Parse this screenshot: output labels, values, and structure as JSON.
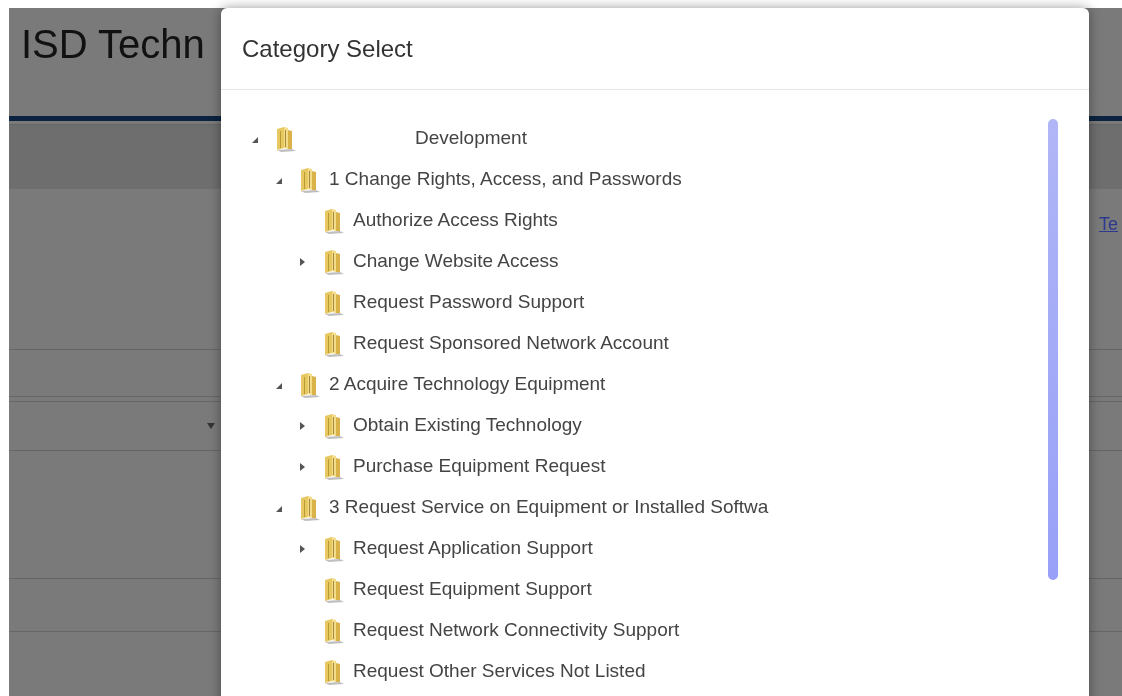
{
  "page": {
    "title": "ISD Techn",
    "link": "Te"
  },
  "dialog": {
    "title": "Category Select",
    "tree": [
      {
        "label": "Development",
        "expanded": true,
        "children": [
          {
            "label": "1 Change Rights, Access, and Passwords",
            "expanded": true,
            "children": [
              {
                "label": "Authorize Access Rights"
              },
              {
                "label": "Change Website Access",
                "expanded": false
              },
              {
                "label": "Request Password Support"
              },
              {
                "label": "Request Sponsored Network Account"
              }
            ]
          },
          {
            "label": "2 Acquire Technology Equipment",
            "expanded": true,
            "children": [
              {
                "label": "Obtain Existing Technology",
                "expanded": false
              },
              {
                "label": "Purchase Equipment Request",
                "expanded": false
              }
            ]
          },
          {
            "label": "3 Request Service on Equipment or Installed Softwa",
            "expanded": true,
            "children": [
              {
                "label": "Request Application Support",
                "expanded": false
              },
              {
                "label": "Request Equipment Support"
              },
              {
                "label": "Request Network Connectivity Support"
              },
              {
                "label": "Request Other Services Not Listed"
              }
            ]
          }
        ]
      }
    ]
  }
}
